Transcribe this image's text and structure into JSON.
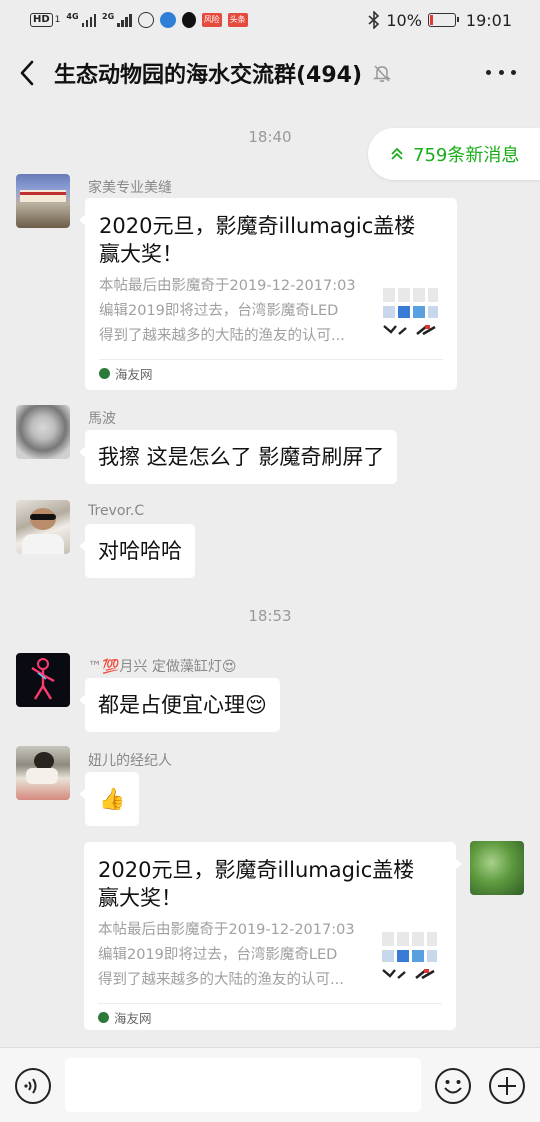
{
  "status_bar": {
    "network_chip": "HD",
    "network_sub": "1",
    "net1_sup": "4G",
    "net2_sup": "2G",
    "app_badge": "风险",
    "app_badge2": "头条",
    "battery": "10%",
    "time": "19:01"
  },
  "header": {
    "title": "生态动物园的海水交流群(494)"
  },
  "new_messages": {
    "label": "759条新消息"
  },
  "timestamps": [
    "18:40",
    "18:53"
  ],
  "messages": [
    {
      "sender": "家美专业美缝",
      "card_title_l1": "2020元旦，影魔奇illumagic盖楼",
      "card_title_l2": "赢大奖！",
      "card_desc_l1": "本帖最后由影魔奇于2019-12-2017:03",
      "card_desc_l2": "编辑2019即将过去，台湾影魔奇LED",
      "card_desc_l3": "得到了越来越多的大陆的渔友的认可...",
      "source": "海友网"
    },
    {
      "sender": "馬波",
      "text": "我擦 这是怎么了 影魔奇刷屏了"
    },
    {
      "sender": "Trevor.C",
      "text": "对哈哈哈"
    },
    {
      "sender": "™💯月兴 定做藻缸灯😍",
      "text": "都是占便宜心理😌"
    },
    {
      "sender": "妞儿的经纪人",
      "text": "👍"
    },
    {
      "card_title_l1": "2020元旦，影魔奇illumagic盖楼",
      "card_title_l2": "赢大奖！",
      "card_desc_l1": "本帖最后由影魔奇于2019-12-2017:03",
      "card_desc_l2": "编辑2019即将过去，台湾影魔奇LED",
      "card_desc_l3": "得到了越来越多的大陆的渔友的认可...",
      "source": "海友网"
    }
  ],
  "colors": {
    "background": "#ededed",
    "accent_green": "#1aad19",
    "bubble": "#ffffff"
  }
}
